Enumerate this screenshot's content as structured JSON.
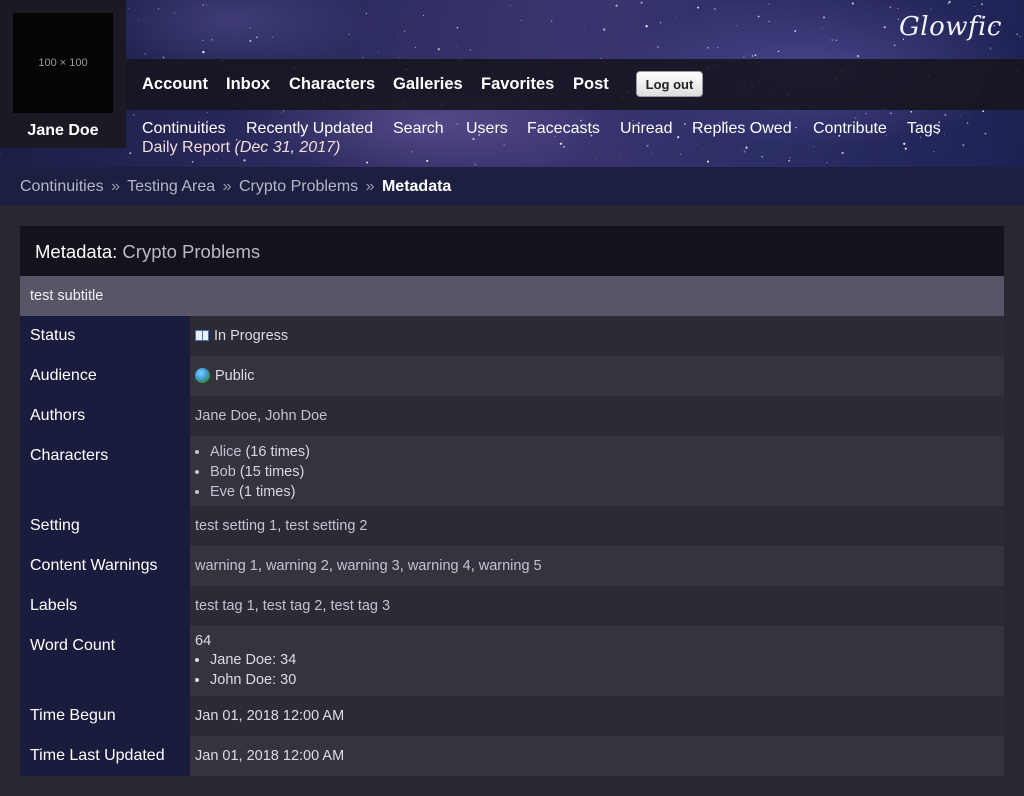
{
  "user": {
    "avatar_placeholder": "100 × 100",
    "name": "Jane Doe"
  },
  "site": {
    "logo": "Glowfic"
  },
  "nav": {
    "items": [
      "Account",
      "Inbox",
      "Characters",
      "Galleries",
      "Favorites",
      "Post"
    ],
    "logout_label": "Log out"
  },
  "subnav": {
    "items": [
      "Continuities",
      "Recently Updated",
      "Search",
      "Users",
      "Facecasts",
      "Unread",
      "Replies Owed",
      "Contribute",
      "Tags"
    ],
    "daily_report": "Daily Report",
    "daily_report_date": "(Dec 31, 2017)"
  },
  "breadcrumb": {
    "items": [
      "Continuities",
      "Testing Area",
      "Crypto Problems"
    ],
    "separator": "»",
    "current": "Metadata"
  },
  "panel": {
    "title_prefix": "Metadata:",
    "title_link": "Crypto Problems",
    "subtitle": "test subtitle"
  },
  "metadata": {
    "status": {
      "label": "Status",
      "value": "In Progress",
      "icon": "book-icon"
    },
    "audience": {
      "label": "Audience",
      "value": "Public",
      "icon": "globe-icon"
    },
    "authors": {
      "label": "Authors",
      "values": [
        "Jane Doe",
        "John Doe"
      ]
    },
    "characters": {
      "label": "Characters",
      "items": [
        {
          "name": "Alice",
          "count": "(16 times)"
        },
        {
          "name": "Bob",
          "count": "(15 times)"
        },
        {
          "name": "Eve",
          "count": "(1 times)"
        }
      ]
    },
    "setting": {
      "label": "Setting",
      "values": [
        "test setting 1",
        "test setting 2"
      ]
    },
    "content_warnings": {
      "label": "Content Warnings",
      "values": [
        "warning 1",
        "warning 2",
        "warning 3",
        "warning 4",
        "warning 5"
      ]
    },
    "labels": {
      "label": "Labels",
      "values": [
        "test tag 1",
        "test tag 2",
        "test tag 3"
      ]
    },
    "word_count": {
      "label": "Word Count",
      "total": "64",
      "breakdown": [
        "Jane Doe: 34",
        "John Doe: 30"
      ]
    },
    "time_begun": {
      "label": "Time Begun",
      "value": "Jan 01, 2018 12:00 AM"
    },
    "time_last_updated": {
      "label": "Time Last Updated",
      "value": "Jan 01, 2018 12:00 AM"
    }
  }
}
